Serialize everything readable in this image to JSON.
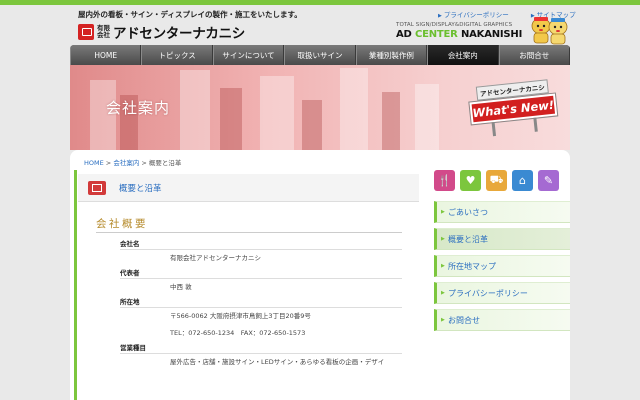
{
  "header": {
    "tagline": "屋内外の看板・サイン・ディスプレイの製作・施工をいたします。",
    "logo_kaisha": "有限会社",
    "logo_name": "アドセンターナカニシ",
    "brand_sub": "TOTAL SIGN/DISPLAY&DIGITAL GRAPHICS",
    "brand_main_1": "AD",
    "brand_main_2": "CENTER",
    "brand_main_3": "NAKANISHI",
    "links": [
      "プライバシーポリシー",
      "サイトマップ"
    ]
  },
  "nav": {
    "items": [
      {
        "label": "HOME"
      },
      {
        "label": "トピックス"
      },
      {
        "label": "サインについて"
      },
      {
        "label": "取扱いサイン"
      },
      {
        "label": "業種別製作例"
      },
      {
        "label": "会社案内"
      },
      {
        "label": "お問合せ"
      }
    ],
    "active_index": 5
  },
  "hero": {
    "title": "会社案内",
    "sign_top": "アドセンターナカニシ",
    "sign_main": "What's New!"
  },
  "breadcrumb": {
    "home": "HOME",
    "sep1": " > ",
    "section": "会社案内",
    "sep2": " > ",
    "current": "概要と沿革"
  },
  "main": {
    "page_title": "概要と沿革",
    "section_title": "会社概要",
    "rows": [
      {
        "label": "会社名",
        "values": [
          "有限会社アドセンターナカニシ"
        ]
      },
      {
        "label": "代表者",
        "values": [
          "中西 敦"
        ]
      },
      {
        "label": "所在地",
        "values": [
          "〒566-0062 大阪府摂津市鳥飼上3丁目20番9号",
          "TEL：072-650-1234　FAX：072-650-1573"
        ]
      },
      {
        "label": "営業種目",
        "values": [
          "屋外広告・店舗・施設サイン・LEDサイン・あらゆる看板の企画・デザイ"
        ]
      }
    ]
  },
  "sidebar": {
    "icon_colors": [
      "#d24a8a",
      "#7cc63d",
      "#e8a83a",
      "#3a8ad2",
      "#a56ad2"
    ],
    "icon_names": [
      "fork-knife-icon",
      "heart-icon",
      "cart-icon",
      "house-icon",
      "pencil-icon"
    ],
    "items": [
      {
        "label": "ごあいさつ"
      },
      {
        "label": "概要と沿革"
      },
      {
        "label": "所在地マップ"
      },
      {
        "label": "プライバシーポリシー"
      },
      {
        "label": "お問合せ"
      }
    ],
    "active_index": 1
  },
  "colors": {
    "accent_green": "#7cc63d",
    "link_blue": "#2a6ec0",
    "sign_red": "#d21f1f"
  }
}
